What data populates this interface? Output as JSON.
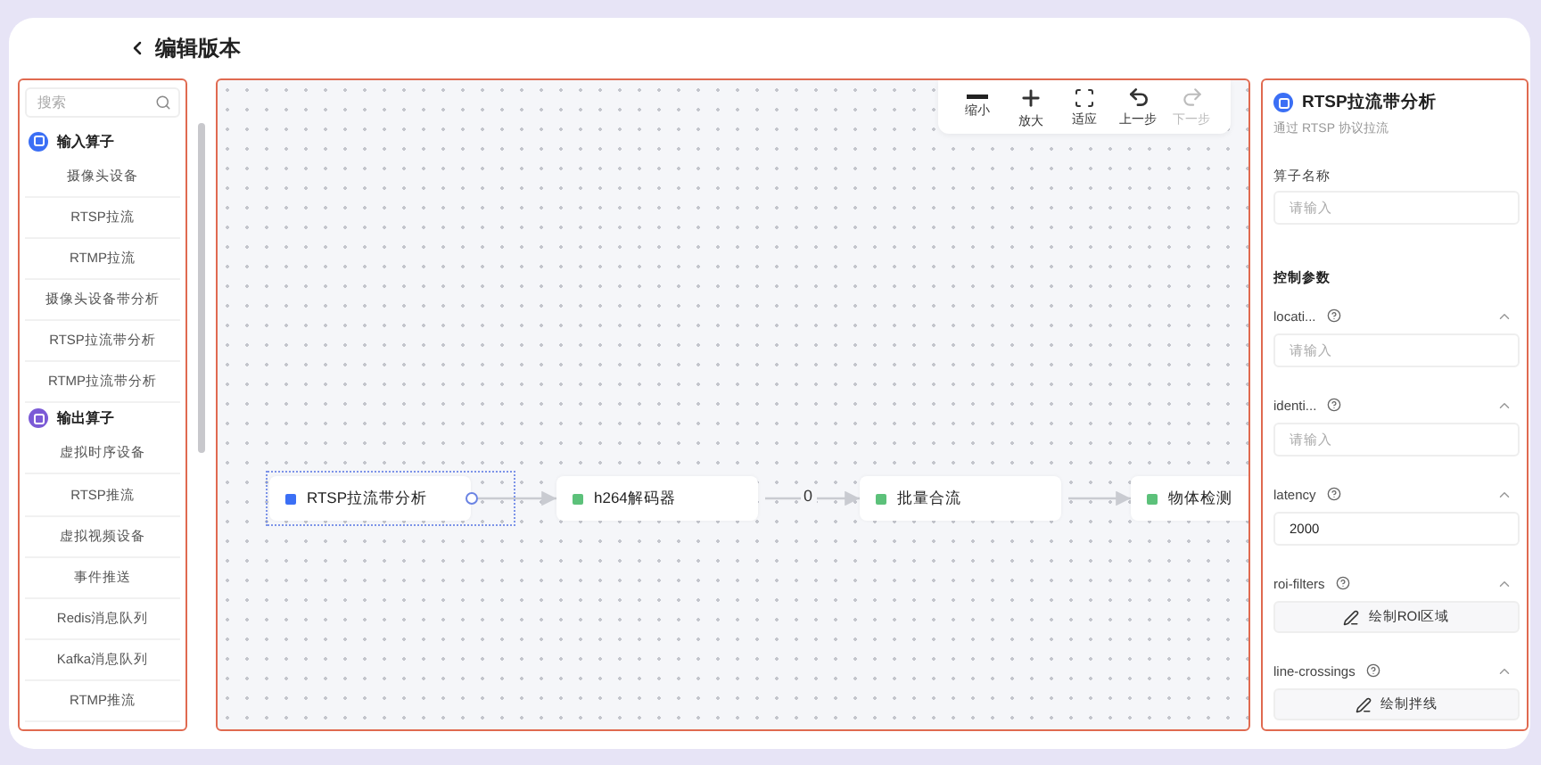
{
  "header": {
    "title": "编辑版本"
  },
  "sidebar": {
    "search": {
      "placeholder": "搜索"
    },
    "groups": [
      {
        "title": "输入算子",
        "color": "#3b6ff5",
        "items": [
          {
            "label": "摄像头设备"
          },
          {
            "label": "RTSP拉流"
          },
          {
            "label": "RTMP拉流"
          },
          {
            "label": "摄像头设备带分析"
          },
          {
            "label": "RTSP拉流带分析"
          },
          {
            "label": "RTMP拉流带分析"
          }
        ]
      },
      {
        "title": "输出算子",
        "color": "#7b5ad6",
        "items": [
          {
            "label": "虚拟时序设备"
          },
          {
            "label": "RTSP推流"
          },
          {
            "label": "虚拟视频设备"
          },
          {
            "label": "事件推送"
          },
          {
            "label": "Redis消息队列"
          },
          {
            "label": "Kafka消息队列"
          },
          {
            "label": "RTMP推流"
          }
        ]
      }
    ]
  },
  "canvas": {
    "toolbar": [
      {
        "kind": "zoom-out",
        "label": "缩小",
        "disabled": false
      },
      {
        "kind": "zoom-in",
        "label": "放大",
        "disabled": false
      },
      {
        "kind": "fit",
        "label": "适应",
        "disabled": false
      },
      {
        "kind": "undo",
        "label": "上一步",
        "disabled": false
      },
      {
        "kind": "redo",
        "label": "下一步",
        "disabled": true
      }
    ],
    "nodes": [
      {
        "label": "RTSP拉流带分析",
        "selected": true,
        "color": "#3b6ff5"
      },
      {
        "label": "h264解码器",
        "selected": false,
        "color": "#5cc17a",
        "out_label": "0"
      },
      {
        "label": "批量合流",
        "selected": false,
        "color": "#5cc17a"
      },
      {
        "label": "物体检测",
        "selected": false,
        "color": "#5cc17a"
      }
    ]
  },
  "panel": {
    "title": "RTSP拉流带分析",
    "subtitle": "通过 RTSP 协议拉流",
    "name_field": {
      "label": "算子名称",
      "placeholder": "请输入"
    },
    "section": "控制参数",
    "params": [
      {
        "kind": "input",
        "label": "locati...",
        "placeholder": "请输入",
        "expanded": true
      },
      {
        "kind": "input",
        "label": "identi...",
        "placeholder": "请输入",
        "expanded": true
      },
      {
        "kind": "input",
        "label": "latency",
        "value": "2000",
        "expanded": true
      },
      {
        "kind": "button",
        "label": "roi-filters",
        "button": "绘制ROI区域",
        "expanded": true
      },
      {
        "kind": "button",
        "label": "line-crossings",
        "button": "绘制拌线",
        "expanded": true
      }
    ]
  }
}
